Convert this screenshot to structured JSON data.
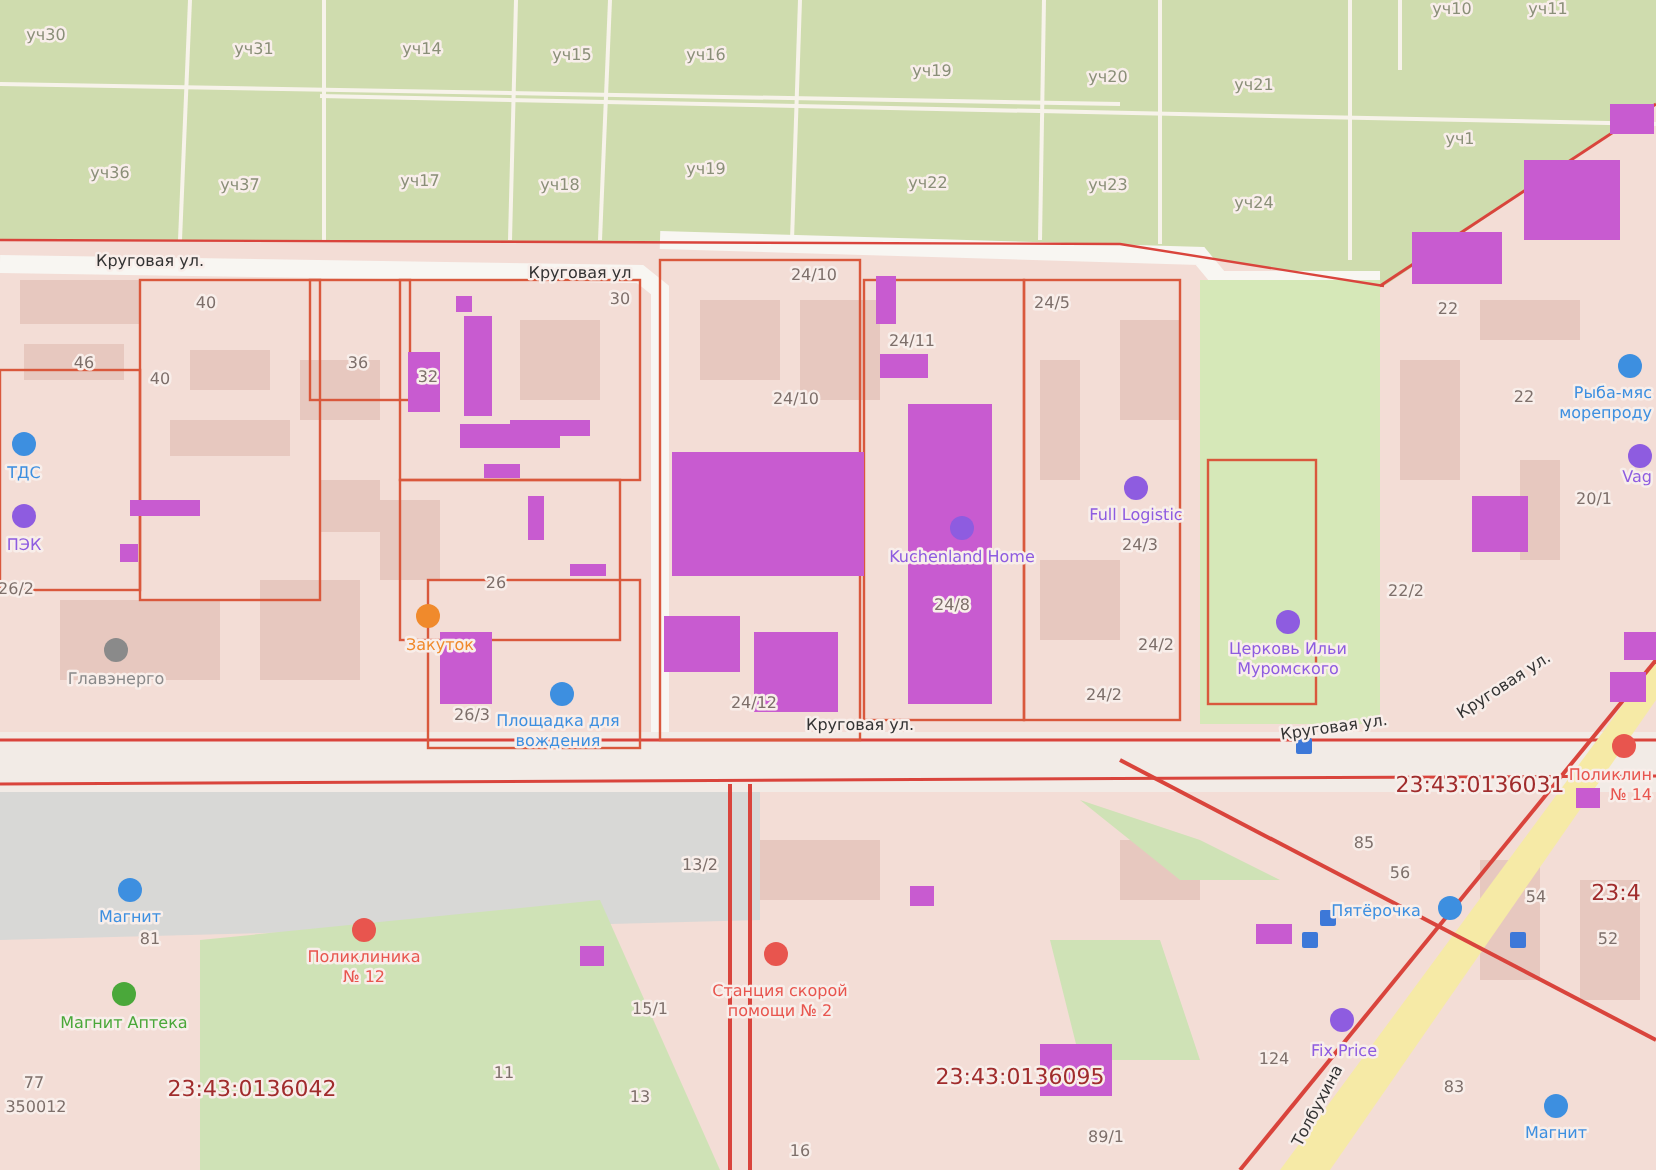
{
  "map": {
    "plot_labels": [
      "уч30",
      "уч31",
      "уч14",
      "уч15",
      "уч16",
      "уч36",
      "уч37",
      "уч17",
      "уч18",
      "уч19",
      "уч19",
      "уч20",
      "уч21",
      "уч22",
      "уч23",
      "уч24",
      "уч1",
      "уч10",
      "уч11"
    ],
    "street_labels": [
      "Круговая ул.",
      "Круговая ул",
      "Круговая ул.",
      "Круговая ул.",
      "Круговая ул.",
      "Толбухина"
    ],
    "house_numbers": [
      "40",
      "46",
      "40",
      "36",
      "32",
      "30",
      "24/10",
      "24/10",
      "24/11",
      "24/5",
      "22",
      "22",
      "20/1",
      "22/2",
      "24/3",
      "24/8",
      "24/2",
      "24/2",
      "26",
      "26/3",
      "26/2",
      "24/12",
      "81",
      "77",
      "350012",
      "13/2",
      "15/1",
      "11",
      "13",
      "16",
      "89/1",
      "124",
      "56",
      "54",
      "52",
      "83",
      "85"
    ],
    "pois": [
      {
        "lines": [
          "ТДС"
        ],
        "color": "#3d8fe0"
      },
      {
        "lines": [
          "ПЭК"
        ],
        "color": "#8e5ce0"
      },
      {
        "lines": [
          "Главэнерго"
        ],
        "color": "#8a8a8a"
      },
      {
        "lines": [
          "Закуток"
        ],
        "color": "#f08a2c"
      },
      {
        "lines": [
          "Площадка для",
          "вождения"
        ],
        "color": "#3d8fe0"
      },
      {
        "lines": [
          "Kuchenland Home"
        ],
        "color": "#8e5ce0"
      },
      {
        "lines": [
          "Full Logistic"
        ],
        "color": "#8e5ce0"
      },
      {
        "lines": [
          "Церковь Ильи",
          "Муромского"
        ],
        "color": "#8e5ce0"
      },
      {
        "lines": [
          "Рыба-мяс",
          "морепроду"
        ],
        "color": "#3d8fe0"
      },
      {
        "lines": [
          "Vag"
        ],
        "color": "#8e5ce0"
      },
      {
        "lines": [
          "Магнит"
        ],
        "color": "#3d8fe0"
      },
      {
        "lines": [
          "Магнит Аптека"
        ],
        "color": "#4aa83a"
      },
      {
        "lines": [
          "Поликлиника",
          "№ 12"
        ],
        "color": "#e8554e"
      },
      {
        "lines": [
          "Станция скорой",
          "помощи № 2"
        ],
        "color": "#e8554e"
      },
      {
        "lines": [
          "Поликлин",
          "№ 14"
        ],
        "color": "#e8554e"
      },
      {
        "lines": [
          "Пятёрочка"
        ],
        "color": "#3d8fe0"
      },
      {
        "lines": [
          "Fix Price"
        ],
        "color": "#8e5ce0"
      },
      {
        "lines": [
          "Магнит"
        ],
        "color": "#3d8fe0"
      }
    ],
    "cadastral_numbers": [
      "23:43:0136031",
      "23:43:0136042",
      "23:43:0136095",
      "23:4"
    ]
  }
}
